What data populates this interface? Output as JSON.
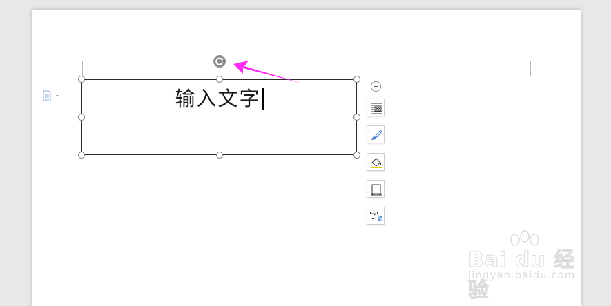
{
  "textbox": {
    "text": "输入文字"
  },
  "side_toolbar": {
    "items": [
      {
        "icon": "text-wrap-icon"
      },
      {
        "icon": "brush-icon"
      },
      {
        "icon": "fill-icon"
      },
      {
        "icon": "border-frame-icon"
      },
      {
        "icon": "text-direction-icon",
        "glyph": "字"
      }
    ]
  },
  "watermark": {
    "brand": "Bai du 经验",
    "url": "jingyan.baidu.com"
  },
  "colors": {
    "annotation_arrow": "#ff2ef5",
    "handle_border": "#7a7a7a",
    "rotate_handle": "#8c8c8c",
    "icon_blue": "#4a7fd1",
    "fill_yellow": "#e8d100"
  }
}
